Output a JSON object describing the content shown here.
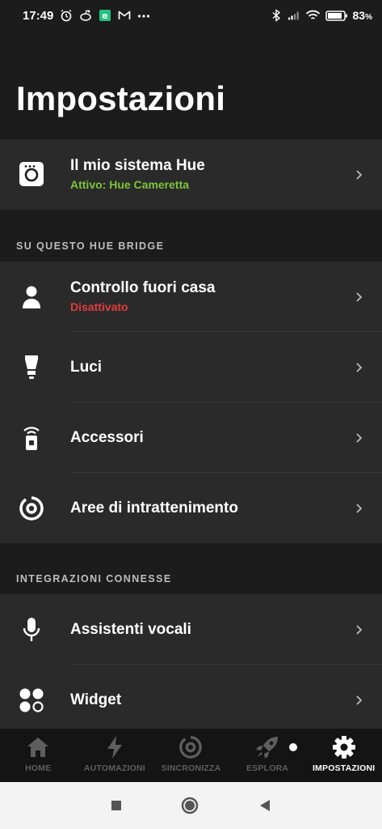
{
  "status_bar": {
    "time": "17:49",
    "battery_pct": "83",
    "battery_unit": "%",
    "icons": [
      "alarm-icon",
      "reddit-icon",
      "app-icon",
      "gmail-icon",
      "more-icon",
      "bluetooth-icon",
      "signal-icon",
      "wifi-icon",
      "battery-icon"
    ]
  },
  "header": {
    "title": "Impostazioni"
  },
  "system": {
    "label": "Il mio sistema Hue",
    "sub": "Attivo: Hue Cameretta",
    "sub_color": "#7cc43a"
  },
  "bridge_section": {
    "heading": "SU QUESTO HUE BRIDGE",
    "items": [
      {
        "label": "Controllo fuori casa",
        "sub": "Disattivato",
        "sub_color": "#e03c3c",
        "icon": "person-icon"
      },
      {
        "label": "Luci",
        "icon": "bulb-icon"
      },
      {
        "label": "Accessori",
        "icon": "remote-icon"
      },
      {
        "label": "Aree di intrattenimento",
        "icon": "entertainment-icon"
      }
    ]
  },
  "integrations_section": {
    "heading": "INTEGRAZIONI CONNESSE",
    "items": [
      {
        "label": "Assistenti vocali",
        "icon": "microphone-icon"
      },
      {
        "label": "Widget",
        "icon": "widget-icon"
      }
    ]
  },
  "bottom_nav": {
    "items": [
      {
        "label": "HOME",
        "icon": "home-icon"
      },
      {
        "label": "AUTOMAZIONI",
        "icon": "bolt-icon"
      },
      {
        "label": "SINCRONIZZA",
        "icon": "sync-icon"
      },
      {
        "label": "ESPLORA",
        "icon": "rocket-icon"
      },
      {
        "label": "IMPOSTAZIONI",
        "icon": "gear-icon",
        "active": true
      }
    ]
  },
  "system_nav": {
    "icons": [
      "recents-icon",
      "home-circle-icon",
      "back-icon"
    ]
  }
}
